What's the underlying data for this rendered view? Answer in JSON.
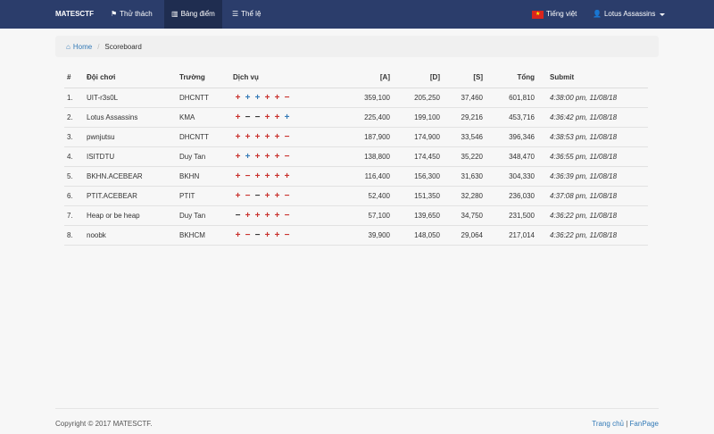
{
  "navbar": {
    "brand": "MATESCTF",
    "challenges": "Thử thách",
    "scoreboard": "Bảng điểm",
    "rules": "Thể lệ",
    "language": "Tiếng việt",
    "user": "Lotus Assassins"
  },
  "breadcrumb": {
    "home": "Home",
    "current": "Scoreboard"
  },
  "table": {
    "headers": [
      "#",
      "Đội chơi",
      "Trường",
      "Dịch vụ",
      "[A]",
      "[D]",
      "[S]",
      "Tổng",
      "Submit"
    ],
    "rows": [
      {
        "rank": "1.",
        "team": "UIT-r3s0L",
        "school": "DHCNTT",
        "services": [
          "plus-red",
          "plus-blue",
          "plus-blue",
          "plus-red",
          "plus-red",
          "minus-red"
        ],
        "a": "359,100",
        "d": "205,250",
        "s": "37,460",
        "total": "601,810",
        "submit": "4:38:00 pm, 11/08/18"
      },
      {
        "rank": "2.",
        "team": "Lotus Assassins",
        "school": "KMA",
        "services": [
          "plus-red",
          "minus-dark",
          "minus-dark",
          "plus-red",
          "plus-red",
          "plus-blue"
        ],
        "a": "225,400",
        "d": "199,100",
        "s": "29,216",
        "total": "453,716",
        "submit": "4:36:42 pm, 11/08/18"
      },
      {
        "rank": "3.",
        "team": "pwnjutsu",
        "school": "DHCNTT",
        "services": [
          "plus-red",
          "plus-red",
          "plus-red",
          "plus-red",
          "plus-red",
          "minus-red"
        ],
        "a": "187,900",
        "d": "174,900",
        "s": "33,546",
        "total": "396,346",
        "submit": "4:38:53 pm, 11/08/18"
      },
      {
        "rank": "4.",
        "team": "ISITDTU",
        "school": "Duy Tan",
        "services": [
          "plus-red",
          "plus-blue",
          "plus-red",
          "plus-red",
          "plus-red",
          "minus-red"
        ],
        "a": "138,800",
        "d": "174,450",
        "s": "35,220",
        "total": "348,470",
        "submit": "4:36:55 pm, 11/08/18"
      },
      {
        "rank": "5.",
        "team": "BKHN.ACEBEAR",
        "school": "BKHN",
        "services": [
          "plus-red",
          "minus-red",
          "plus-red",
          "plus-red",
          "plus-red",
          "plus-red"
        ],
        "a": "116,400",
        "d": "156,300",
        "s": "31,630",
        "total": "304,330",
        "submit": "4:36:39 pm, 11/08/18"
      },
      {
        "rank": "6.",
        "team": "PTIT.ACEBEAR",
        "school": "PTIT",
        "services": [
          "plus-red",
          "minus-red",
          "minus-dark",
          "plus-red",
          "plus-red",
          "minus-red"
        ],
        "a": "52,400",
        "d": "151,350",
        "s": "32,280",
        "total": "236,030",
        "submit": "4:37:08 pm, 11/08/18"
      },
      {
        "rank": "7.",
        "team": "Heap or be heap",
        "school": "Duy Tan",
        "services": [
          "minus-dark",
          "plus-red",
          "plus-red",
          "plus-red",
          "plus-red",
          "minus-red"
        ],
        "a": "57,100",
        "d": "139,650",
        "s": "34,750",
        "total": "231,500",
        "submit": "4:36:22 pm, 11/08/18"
      },
      {
        "rank": "8.",
        "team": "noobk",
        "school": "BKHCM",
        "services": [
          "plus-red",
          "minus-red",
          "minus-dark",
          "plus-red",
          "plus-red",
          "minus-red"
        ],
        "a": "39,900",
        "d": "148,050",
        "s": "29,064",
        "total": "217,014",
        "submit": "4:36:22 pm, 11/08/18"
      }
    ]
  },
  "footer": {
    "copyright": "Copyright © 2017 MATESCTF.",
    "link1": "Trang chủ",
    "divider": "|",
    "link2": "FanPage"
  }
}
